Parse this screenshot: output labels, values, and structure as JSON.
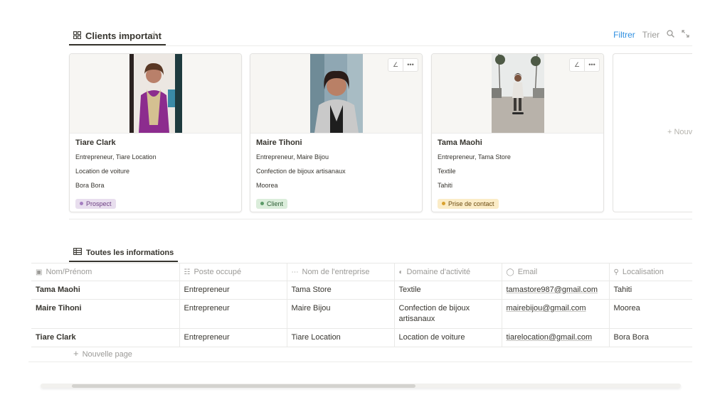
{
  "gallery": {
    "view_name": "Clients important",
    "add_view": "+",
    "toolbar": {
      "filter": "Filtrer",
      "sort": "Trier"
    },
    "new_card": "+ Nouv",
    "cards": [
      {
        "name": "Tiare Clark",
        "poste": "Entrepreneur, Tiare Location",
        "domaine": "Location de voiture",
        "lieu": "Bora Bora",
        "status": "Prospect",
        "status_bg": "#e8deee",
        "status_fg": "#6c3e82",
        "status_dot": "#a47ec0"
      },
      {
        "name": "Maire Tihoni",
        "poste": "Entrepreneur, Maire Bijou",
        "domaine": "Confection de bijoux artisanaux",
        "lieu": "Moorea",
        "status": "Client",
        "status_bg": "#dbeddb",
        "status_fg": "#2d5e35",
        "status_dot": "#5b9a68"
      },
      {
        "name": "Tama Maohi",
        "poste": "Entrepreneur, Tama Store",
        "domaine": "Textile",
        "lieu": "Tahiti",
        "status": "Prise de contact",
        "status_bg": "#fbecc7",
        "status_fg": "#6b4b12",
        "status_dot": "#d9a12f"
      }
    ]
  },
  "table": {
    "view_name": "Toutes les informations",
    "columns": [
      "Nom/Prénom",
      "Poste occupé",
      "Nom de l'entreprise",
      "Domaine d'activité",
      "Email",
      "Localisation"
    ],
    "rows": [
      [
        "Tama Maohi",
        "Entrepreneur",
        "Tama Store",
        "Textile",
        "tamastore987@gmail.com",
        "Tahiti"
      ],
      [
        "Maire Tihoni",
        "Entrepreneur",
        "Maire Bijou",
        "Confection de bijoux artisanaux",
        "mairebijou@gmail.com",
        "Moorea"
      ],
      [
        "Tiare Clark",
        "Entrepreneur",
        "Tiare Location",
        "Location de voiture",
        "tiarelocation@gmail.com",
        "Bora Bora"
      ]
    ],
    "new_page": "Nouvelle page"
  },
  "icons": {
    "gallery_view": "grid-icon",
    "table_view": "table-icon",
    "search": "search-icon",
    "expand": "expand-icon",
    "edit": "pencil-icon",
    "more": "more-icon"
  }
}
